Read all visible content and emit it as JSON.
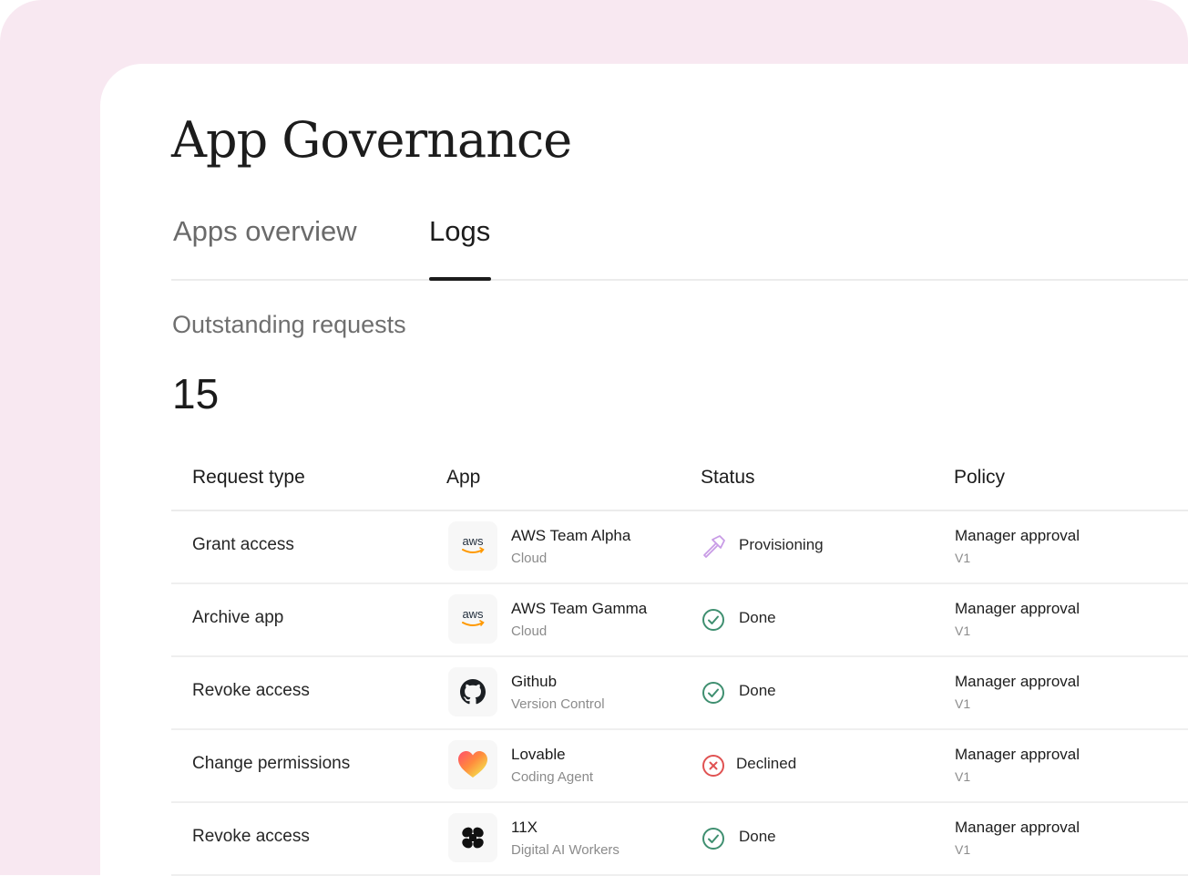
{
  "page": {
    "title": "App Governance"
  },
  "tabs": [
    {
      "label": "Apps overview",
      "active": false
    },
    {
      "label": "Logs",
      "active": true
    }
  ],
  "summary": {
    "label": "Outstanding requests",
    "count": "15"
  },
  "table": {
    "headers": {
      "request_type": "Request type",
      "app": "App",
      "status": "Status",
      "policy": "Policy"
    },
    "rows": [
      {
        "request_type": "Grant access",
        "app_name": "AWS Team Alpha",
        "app_category": "Cloud",
        "app_icon": "aws-logo-icon",
        "status": "Provisioning",
        "status_icon": "hammer-icon",
        "policy_name": "Manager approval",
        "policy_version": "V1"
      },
      {
        "request_type": "Archive app",
        "app_name": "AWS Team Gamma",
        "app_category": "Cloud",
        "app_icon": "aws-logo-icon",
        "status": "Done",
        "status_icon": "check-circle-icon",
        "policy_name": "Manager approval",
        "policy_version": "V1"
      },
      {
        "request_type": "Revoke access",
        "app_name": "Github",
        "app_category": "Version Control",
        "app_icon": "github-logo-icon",
        "status": "Done",
        "status_icon": "check-circle-icon",
        "policy_name": "Manager approval",
        "policy_version": "V1"
      },
      {
        "request_type": "Change permissions",
        "app_name": "Lovable",
        "app_category": "Coding Agent",
        "app_icon": "lovable-heart-icon",
        "status": "Declined",
        "status_icon": "x-circle-icon",
        "policy_name": "Manager approval",
        "policy_version": "V1"
      },
      {
        "request_type": "Revoke access",
        "app_name": "11X",
        "app_category": "Digital AI Workers",
        "app_icon": "11x-logo-icon",
        "status": "Done",
        "status_icon": "check-circle-icon",
        "policy_name": "Manager approval",
        "policy_version": "V1"
      }
    ]
  },
  "logos": {
    "aws_text": "aws"
  },
  "colors": {
    "backdrop": "#f8e8f1",
    "done": "#3f8f70",
    "declined": "#e05252",
    "provisioning": "#c89be6",
    "aws_smile": "#ff9900"
  }
}
